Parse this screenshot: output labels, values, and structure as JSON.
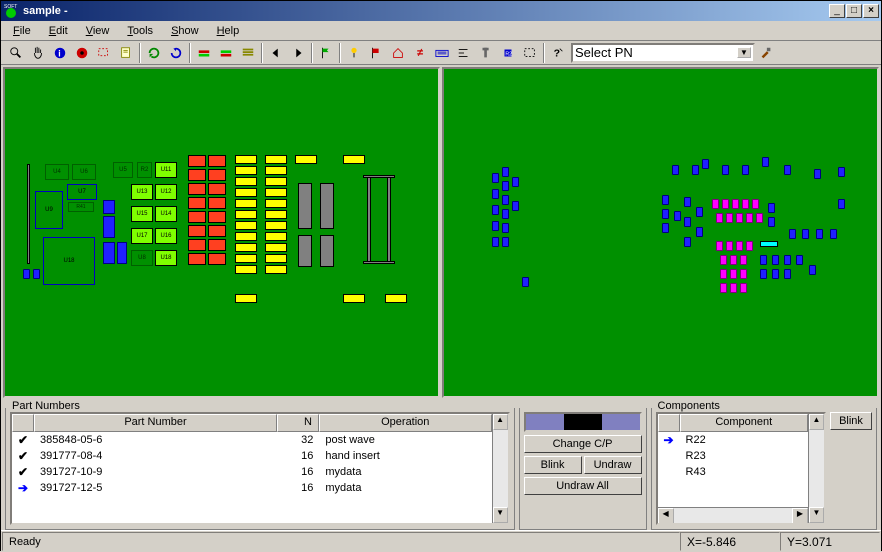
{
  "window": {
    "title": "sample -"
  },
  "menu": {
    "file": "File",
    "edit": "Edit",
    "view": "View",
    "tools": "Tools",
    "show": "Show",
    "help": "Help"
  },
  "toolbar_icons": [
    "search-icon",
    "pan-icon",
    "info-icon",
    "target-icon",
    "rect-select-icon",
    "sheet-icon",
    "refresh-icon",
    "rotate-icon",
    "layer1-icon",
    "layer2-icon",
    "layers-icon",
    "prev-icon",
    "next-icon",
    "flag-icon",
    "thumbtack-icon",
    "redflag-icon",
    "home-icon",
    "noteq-icon",
    "keyboard-icon",
    "align-icon",
    "tool-icon",
    "chip-icon",
    "area-icon",
    "help-icon"
  ],
  "pn_selector": {
    "placeholder": "Select PN"
  },
  "part_numbers_panel": {
    "legend": "Part Numbers",
    "columns": {
      "pn": "Part Number",
      "n": "N",
      "op": "Operation"
    },
    "rows": [
      {
        "check": true,
        "pn": "385848-05-6",
        "n": "32",
        "op": "post wave"
      },
      {
        "check": true,
        "pn": "391777-08-4",
        "n": "16",
        "op": "hand insert"
      },
      {
        "check": true,
        "pn": "391727-10-9",
        "n": "16",
        "op": "mydata"
      },
      {
        "check": false,
        "pn": "391727-12-5",
        "n": "16",
        "op": "mydata"
      }
    ]
  },
  "mid_panel": {
    "cp_button": "Change C/P",
    "blink_button": "Blink",
    "undraw_button": "Undraw",
    "undraw_all_button": "Undraw All"
  },
  "components_panel": {
    "legend": "Components",
    "column": "Component",
    "rows": [
      "R22",
      "R23",
      "R43"
    ],
    "blink_button": "Blink"
  },
  "status": {
    "ready": "Ready",
    "x": "X=-5.846",
    "y": "Y=3.071"
  },
  "board_left": {
    "labels": [
      "U4",
      "U6",
      "U5",
      "R2",
      "U11",
      "U7",
      "U13",
      "U12",
      "U9",
      "R41",
      "U15",
      "U14",
      "U17",
      "U16",
      "U18",
      "U8",
      "U18"
    ]
  }
}
